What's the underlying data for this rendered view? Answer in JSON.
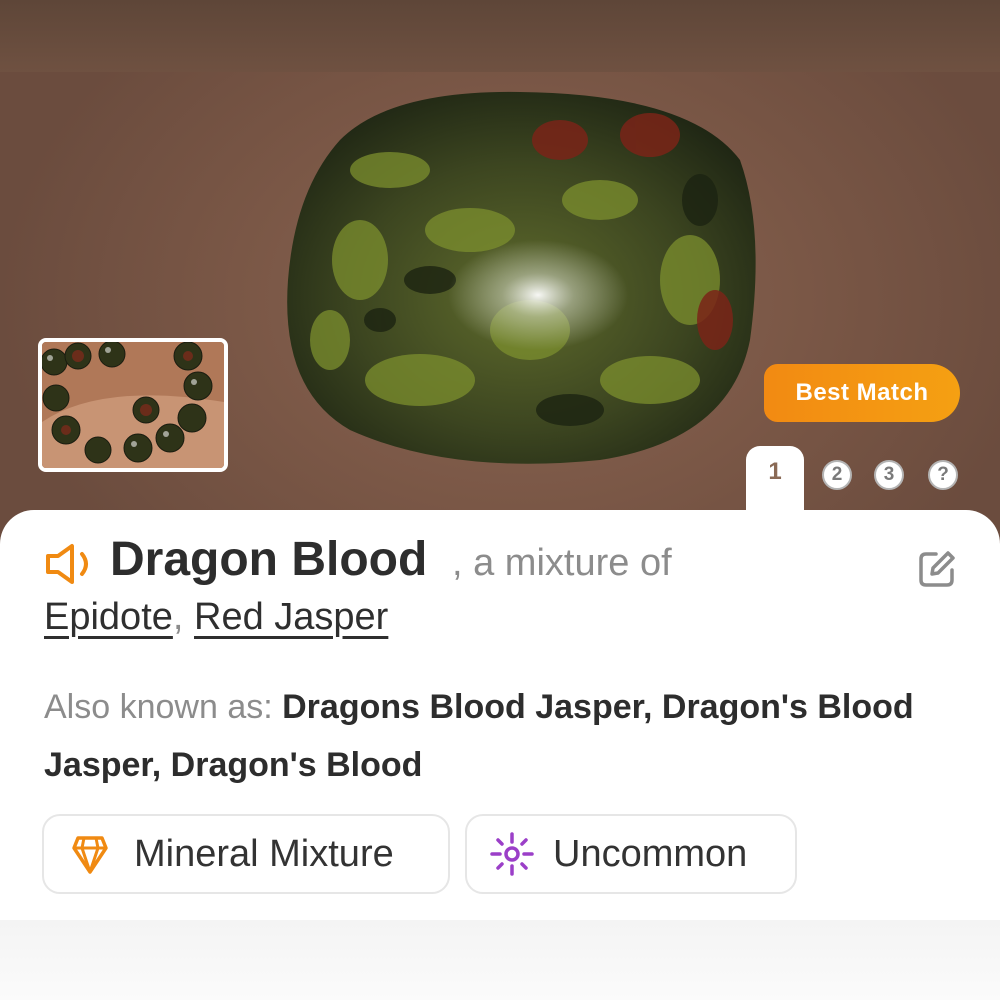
{
  "badge": {
    "best_match": "Best Match"
  },
  "pagination": {
    "pages": [
      "1",
      "2",
      "3",
      "?"
    ],
    "active": "1"
  },
  "result": {
    "name": "Dragon Blood",
    "mixture_prefix": ", a mixture of",
    "components": [
      "Epidote",
      "Red Jasper"
    ],
    "component_separator": ",",
    "aka_label": "Also known as: ",
    "aka_names": "Dragons Blood Jasper, Dragon's Blood Jasper, Dragon's Blood"
  },
  "chips": [
    {
      "label": "Mineral Mixture",
      "icon": "crystal-icon",
      "color": "#f08a12"
    },
    {
      "label": "Uncommon",
      "icon": "sparkle-icon",
      "color": "#9b3fc8"
    }
  ],
  "colors": {
    "accent": "#f28a12",
    "rarity": "#9b3fc8"
  },
  "icons": {
    "speaker": "speaker-icon",
    "edit": "edit-icon"
  }
}
